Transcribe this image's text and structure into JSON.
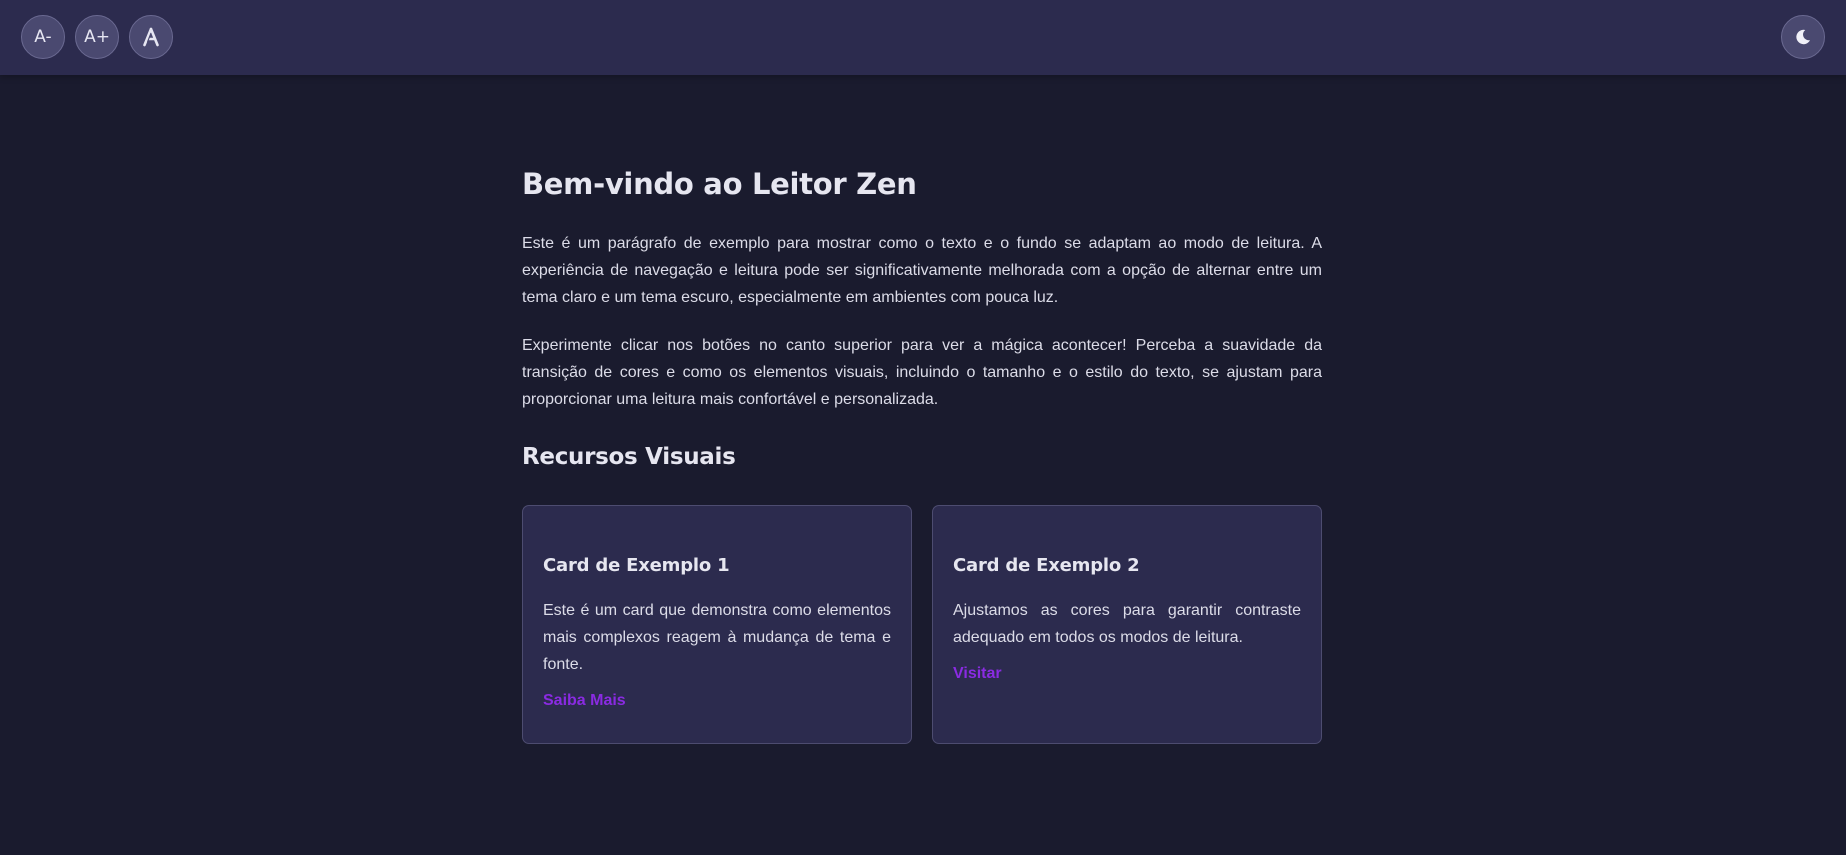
{
  "toolbar": {
    "decrease_font_label": "A-",
    "increase_font_label": "A+",
    "font_style_label": "𝔸",
    "theme_toggle_icon": "moon-icon"
  },
  "article": {
    "title": "Bem-vindo ao Leitor Zen",
    "paragraphs": [
      "Este é um parágrafo de exemplo para mostrar como o texto e o fundo se adaptam ao modo de leitura. A experiência de navegação e leitura pode ser significativamente melhorada com a opção de alternar entre um tema claro e um tema escuro, especialmente em ambientes com pouca luz.",
      "Experimente clicar nos botões no canto superior para ver a mágica acontecer! Perceba a suavidade da transição de cores e como os elementos visuais, incluindo o tamanho e o estilo do texto, se ajustam para proporcionar uma leitura mais confortável e personalizada."
    ],
    "section_title": "Recursos Visuais"
  },
  "cards": [
    {
      "title": "Card de Exemplo 1",
      "text": "Este é um card que demonstra como elementos mais complexos reagem à mudança de tema e fonte.",
      "link": "Saiba Mais"
    },
    {
      "title": "Card de Exemplo 2",
      "text": "Ajustamos as cores para garantir contraste adequado em todos os modos de leitura.",
      "link": "Visitar"
    }
  ],
  "colors": {
    "background": "#1a1b2e",
    "surface": "#2c2b4e",
    "accent": "#8a2be2",
    "text": "#e4e4ee"
  }
}
